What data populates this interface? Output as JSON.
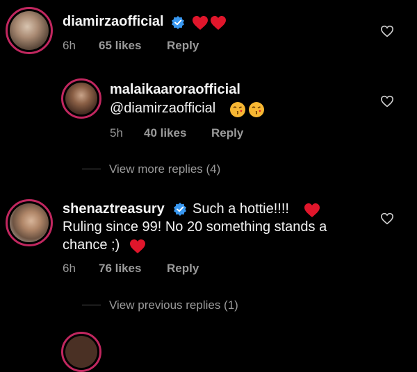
{
  "comments": [
    {
      "username": "diamirzaofficial",
      "verified": true,
      "text_emojis": [
        "red-heart",
        "red-heart"
      ],
      "time": "6h",
      "likes": "65 likes",
      "reply": "Reply"
    },
    {
      "username": "malaikaaroraofficial",
      "verified": false,
      "text": "@diamirzaofficial",
      "text_emojis": [
        "kissing-face",
        "kissing-face"
      ],
      "time": "5h",
      "likes": "40 likes",
      "reply": "Reply"
    },
    {
      "username": "shenaztreasury",
      "verified": true,
      "text_line1": "Such a hottie!!!!",
      "text_line2": "Ruling since 99! No 20 something stands a",
      "text_line3": "chance ;)",
      "time": "6h",
      "likes": "76 likes",
      "reply": "Reply"
    }
  ],
  "view_more_replies": "View more replies (4)",
  "view_previous_replies": "View previous replies (1)",
  "colors": {
    "background": "#000000",
    "story_ring": "#c1275f",
    "verified_badge": "#3897f0",
    "heart": "#ed4956",
    "secondary_text": "#9a9a9a"
  }
}
